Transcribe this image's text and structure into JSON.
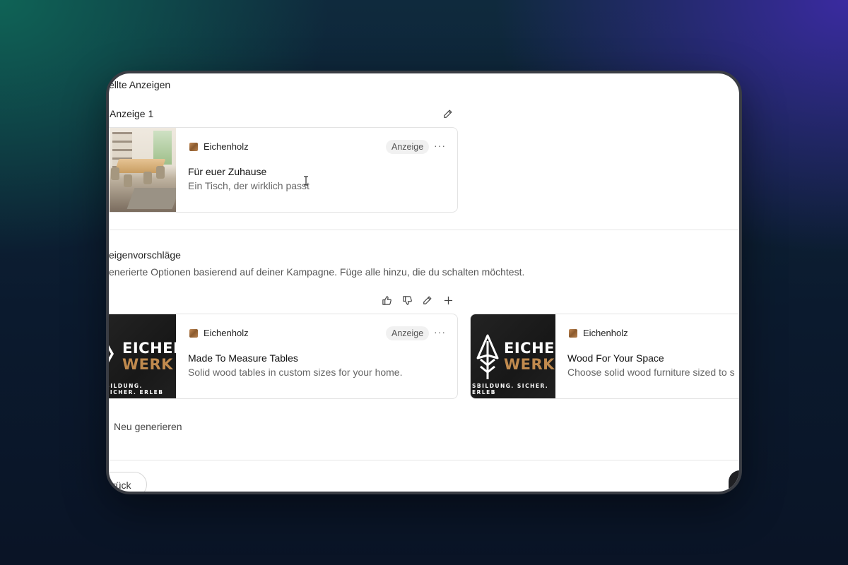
{
  "section": {
    "title": "ellte Anzeigen",
    "ad_label": "Anzeige 1"
  },
  "created_ad": {
    "brand": "Eichenholz",
    "badge": "Anzeige",
    "more": "···",
    "title": "Für euer Zuhause",
    "description": "Ein Tisch, der wirklich passt"
  },
  "suggestions": {
    "title": "eigenvorschläge",
    "description": "enerierte Optionen basierend auf deiner Kampagne. Füge alle hinzu, die du schalten möchtest.",
    "cards": [
      {
        "brand": "Eichenholz",
        "badge": "Anzeige",
        "more": "···",
        "title": "Made To Measure Tables",
        "description": "Solid wood tables in custom sizes for your home.",
        "logo_line1": "EICHEN",
        "logo_line2": "WERK",
        "logo_tag": "BILDUNG. SICHER. ERLEB"
      },
      {
        "brand": "Eichenholz",
        "title": "Wood For Your Space",
        "description": "Choose solid wood furniture sized to s",
        "logo_line1": "EICHEN",
        "logo_line2": "WERK",
        "logo_tag": "SBILDUNG. SICHER. ERLEB"
      }
    ],
    "regenerate_label": "Neu generieren"
  },
  "footer": {
    "back_label": "rück"
  },
  "colors": {
    "logo_accent": "#c08a4e",
    "badge_bg": "#f1f1f1"
  },
  "icons": [
    "edit-icon",
    "thumbs-up-icon",
    "thumbs-down-icon",
    "plus-icon",
    "more-icon",
    "cursor-icon"
  ]
}
